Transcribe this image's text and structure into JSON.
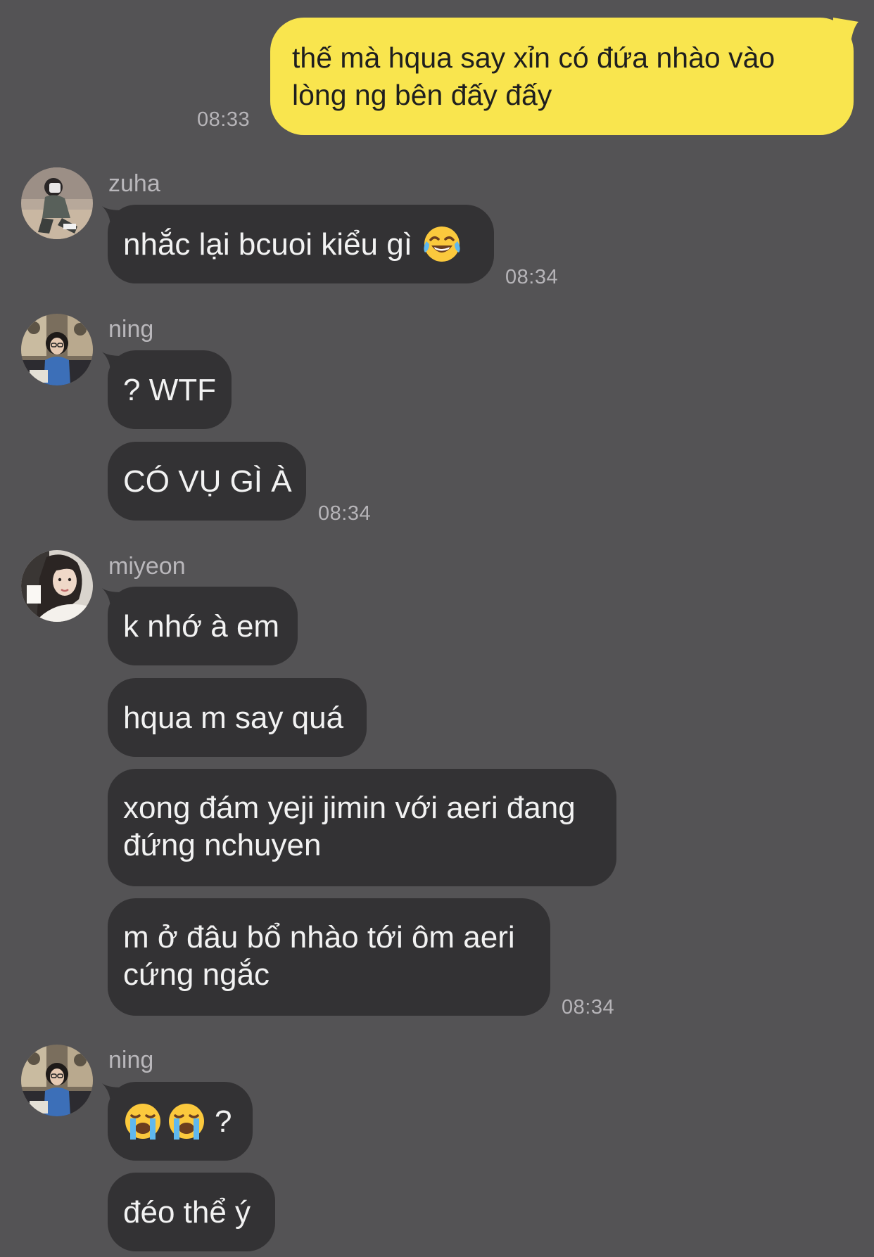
{
  "outgoing": {
    "text": "thế mà hqua say xỉn có đứa nhào vào lòng ng bên đấy đấy",
    "time": "08:33"
  },
  "groups": [
    {
      "sender": "zuha",
      "avatar": "avatar-zuha",
      "messages": [
        {
          "text": "nhắc lại bcuoi kiểu gì",
          "emoji": "face-with-tears-of-joy-icon"
        }
      ],
      "time": "08:34"
    },
    {
      "sender": "ning",
      "avatar": "avatar-ning",
      "messages": [
        {
          "text": "? WTF"
        },
        {
          "text": "CÓ VỤ GÌ À"
        }
      ],
      "time": "08:34"
    },
    {
      "sender": "miyeon",
      "avatar": "avatar-miyeon",
      "messages": [
        {
          "text": "k nhớ à em"
        },
        {
          "text": "hqua m say quá"
        },
        {
          "text": "xong đám yeji jimin với aeri đang đứng nchuyen"
        },
        {
          "text": "m ở đâu bổ nhào tới ôm aeri cứng ngắc"
        }
      ],
      "time": "08:34"
    },
    {
      "sender": "ning",
      "avatar": "avatar-ning",
      "messages": [
        {
          "text": "?",
          "emoji": "loudly-crying-face-icon"
        },
        {
          "text": "đéo thể ý"
        }
      ]
    }
  ],
  "colors": {
    "background": "#545355",
    "outgoing_bubble": "#f9e54e",
    "incoming_bubble": "#333234",
    "timestamp": "#b6b4b8"
  }
}
